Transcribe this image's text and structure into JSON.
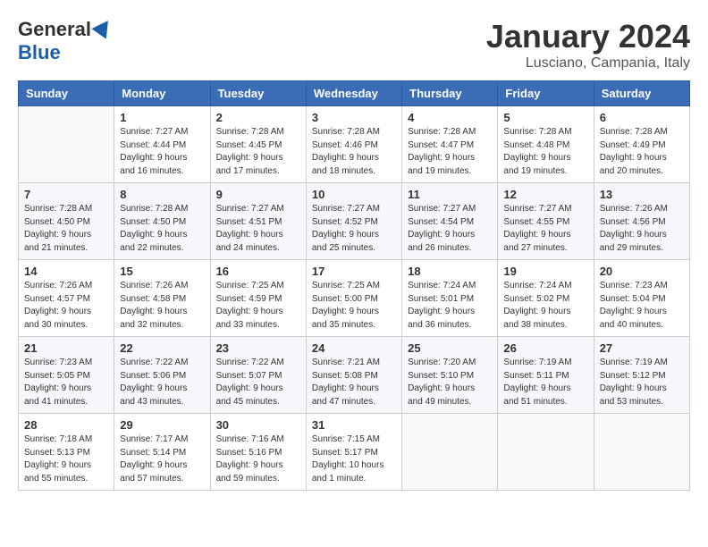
{
  "logo": {
    "general": "General",
    "blue": "Blue"
  },
  "title": "January 2024",
  "location": "Lusciano, Campania, Italy",
  "days_of_week": [
    "Sunday",
    "Monday",
    "Tuesday",
    "Wednesday",
    "Thursday",
    "Friday",
    "Saturday"
  ],
  "weeks": [
    [
      {
        "day": "",
        "info": ""
      },
      {
        "day": "1",
        "info": "Sunrise: 7:27 AM\nSunset: 4:44 PM\nDaylight: 9 hours\nand 16 minutes."
      },
      {
        "day": "2",
        "info": "Sunrise: 7:28 AM\nSunset: 4:45 PM\nDaylight: 9 hours\nand 17 minutes."
      },
      {
        "day": "3",
        "info": "Sunrise: 7:28 AM\nSunset: 4:46 PM\nDaylight: 9 hours\nand 18 minutes."
      },
      {
        "day": "4",
        "info": "Sunrise: 7:28 AM\nSunset: 4:47 PM\nDaylight: 9 hours\nand 19 minutes."
      },
      {
        "day": "5",
        "info": "Sunrise: 7:28 AM\nSunset: 4:48 PM\nDaylight: 9 hours\nand 19 minutes."
      },
      {
        "day": "6",
        "info": "Sunrise: 7:28 AM\nSunset: 4:49 PM\nDaylight: 9 hours\nand 20 minutes."
      }
    ],
    [
      {
        "day": "7",
        "info": "Sunrise: 7:28 AM\nSunset: 4:50 PM\nDaylight: 9 hours\nand 21 minutes."
      },
      {
        "day": "8",
        "info": "Sunrise: 7:28 AM\nSunset: 4:50 PM\nDaylight: 9 hours\nand 22 minutes."
      },
      {
        "day": "9",
        "info": "Sunrise: 7:27 AM\nSunset: 4:51 PM\nDaylight: 9 hours\nand 24 minutes."
      },
      {
        "day": "10",
        "info": "Sunrise: 7:27 AM\nSunset: 4:52 PM\nDaylight: 9 hours\nand 25 minutes."
      },
      {
        "day": "11",
        "info": "Sunrise: 7:27 AM\nSunset: 4:54 PM\nDaylight: 9 hours\nand 26 minutes."
      },
      {
        "day": "12",
        "info": "Sunrise: 7:27 AM\nSunset: 4:55 PM\nDaylight: 9 hours\nand 27 minutes."
      },
      {
        "day": "13",
        "info": "Sunrise: 7:26 AM\nSunset: 4:56 PM\nDaylight: 9 hours\nand 29 minutes."
      }
    ],
    [
      {
        "day": "14",
        "info": "Sunrise: 7:26 AM\nSunset: 4:57 PM\nDaylight: 9 hours\nand 30 minutes."
      },
      {
        "day": "15",
        "info": "Sunrise: 7:26 AM\nSunset: 4:58 PM\nDaylight: 9 hours\nand 32 minutes."
      },
      {
        "day": "16",
        "info": "Sunrise: 7:25 AM\nSunset: 4:59 PM\nDaylight: 9 hours\nand 33 minutes."
      },
      {
        "day": "17",
        "info": "Sunrise: 7:25 AM\nSunset: 5:00 PM\nDaylight: 9 hours\nand 35 minutes."
      },
      {
        "day": "18",
        "info": "Sunrise: 7:24 AM\nSunset: 5:01 PM\nDaylight: 9 hours\nand 36 minutes."
      },
      {
        "day": "19",
        "info": "Sunrise: 7:24 AM\nSunset: 5:02 PM\nDaylight: 9 hours\nand 38 minutes."
      },
      {
        "day": "20",
        "info": "Sunrise: 7:23 AM\nSunset: 5:04 PM\nDaylight: 9 hours\nand 40 minutes."
      }
    ],
    [
      {
        "day": "21",
        "info": "Sunrise: 7:23 AM\nSunset: 5:05 PM\nDaylight: 9 hours\nand 41 minutes."
      },
      {
        "day": "22",
        "info": "Sunrise: 7:22 AM\nSunset: 5:06 PM\nDaylight: 9 hours\nand 43 minutes."
      },
      {
        "day": "23",
        "info": "Sunrise: 7:22 AM\nSunset: 5:07 PM\nDaylight: 9 hours\nand 45 minutes."
      },
      {
        "day": "24",
        "info": "Sunrise: 7:21 AM\nSunset: 5:08 PM\nDaylight: 9 hours\nand 47 minutes."
      },
      {
        "day": "25",
        "info": "Sunrise: 7:20 AM\nSunset: 5:10 PM\nDaylight: 9 hours\nand 49 minutes."
      },
      {
        "day": "26",
        "info": "Sunrise: 7:19 AM\nSunset: 5:11 PM\nDaylight: 9 hours\nand 51 minutes."
      },
      {
        "day": "27",
        "info": "Sunrise: 7:19 AM\nSunset: 5:12 PM\nDaylight: 9 hours\nand 53 minutes."
      }
    ],
    [
      {
        "day": "28",
        "info": "Sunrise: 7:18 AM\nSunset: 5:13 PM\nDaylight: 9 hours\nand 55 minutes."
      },
      {
        "day": "29",
        "info": "Sunrise: 7:17 AM\nSunset: 5:14 PM\nDaylight: 9 hours\nand 57 minutes."
      },
      {
        "day": "30",
        "info": "Sunrise: 7:16 AM\nSunset: 5:16 PM\nDaylight: 9 hours\nand 59 minutes."
      },
      {
        "day": "31",
        "info": "Sunrise: 7:15 AM\nSunset: 5:17 PM\nDaylight: 10 hours\nand 1 minute."
      },
      {
        "day": "",
        "info": ""
      },
      {
        "day": "",
        "info": ""
      },
      {
        "day": "",
        "info": ""
      }
    ]
  ]
}
